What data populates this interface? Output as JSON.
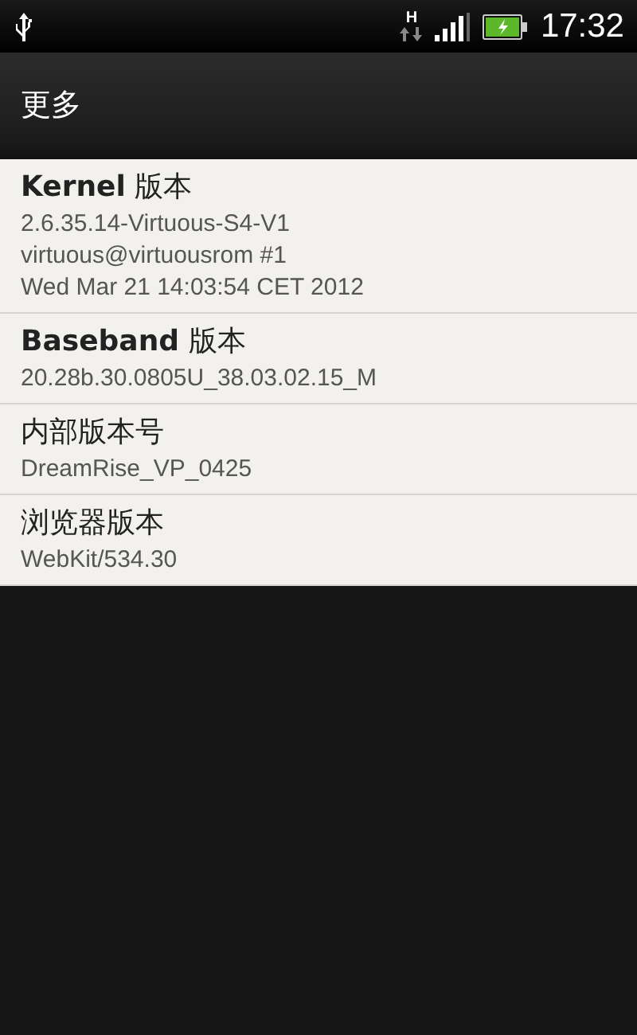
{
  "status_bar": {
    "network_type": "H",
    "time": "17:32"
  },
  "title": "更多",
  "items": [
    {
      "title": "**Kernel** 版本",
      "lines": [
        "2.6.35.14-Virtuous-S4-V1",
        "virtuous@virtuousrom #1",
        "Wed Mar 21 14:03:54 CET 2012"
      ]
    },
    {
      "title": "**Baseband** 版本",
      "lines": [
        "20.28b.30.0805U_38.03.02.15_M"
      ]
    },
    {
      "title": "内部版本号",
      "lines": [
        "DreamRise_VP_0425"
      ]
    },
    {
      "title": "浏览器版本",
      "lines": [
        "WebKit/534.30"
      ]
    }
  ]
}
